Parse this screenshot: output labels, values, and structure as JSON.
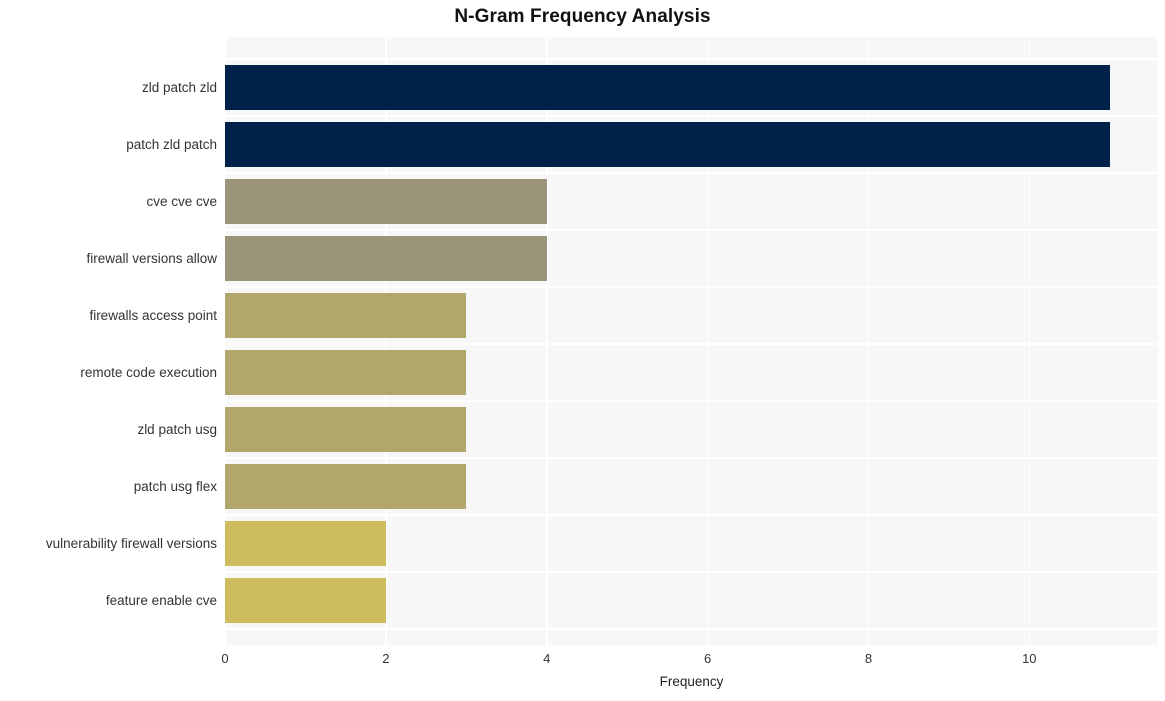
{
  "chart_data": {
    "type": "bar",
    "orientation": "horizontal",
    "title": "N-Gram Frequency Analysis",
    "xlabel": "Frequency",
    "ylabel": "",
    "categories": [
      "zld patch zld",
      "patch zld patch",
      "cve cve cve",
      "firewall versions allow",
      "firewalls access point",
      "remote code execution",
      "zld patch usg",
      "patch usg flex",
      "vulnerability firewall versions",
      "feature enable cve"
    ],
    "values": [
      11,
      11,
      4,
      4,
      3,
      3,
      3,
      3,
      2,
      2
    ],
    "bar_colors": [
      "#00214a",
      "#00214a",
      "#9b9478",
      "#9b9478",
      "#b2a76b",
      "#b2a76b",
      "#b2a76b",
      "#b2a76b",
      "#cdbc5d",
      "#cdbc5d"
    ],
    "xlim": [
      0,
      11.6
    ],
    "xticks": [
      0,
      2,
      4,
      6,
      8,
      10
    ],
    "xtick_labels": [
      "0",
      "2",
      "4",
      "6",
      "8",
      "10"
    ],
    "grid": true,
    "grid_color": "#ffffff",
    "plot_background": "#f7f7f7",
    "figure_background": "#ffffff",
    "legend": null,
    "legend_position": "none"
  }
}
